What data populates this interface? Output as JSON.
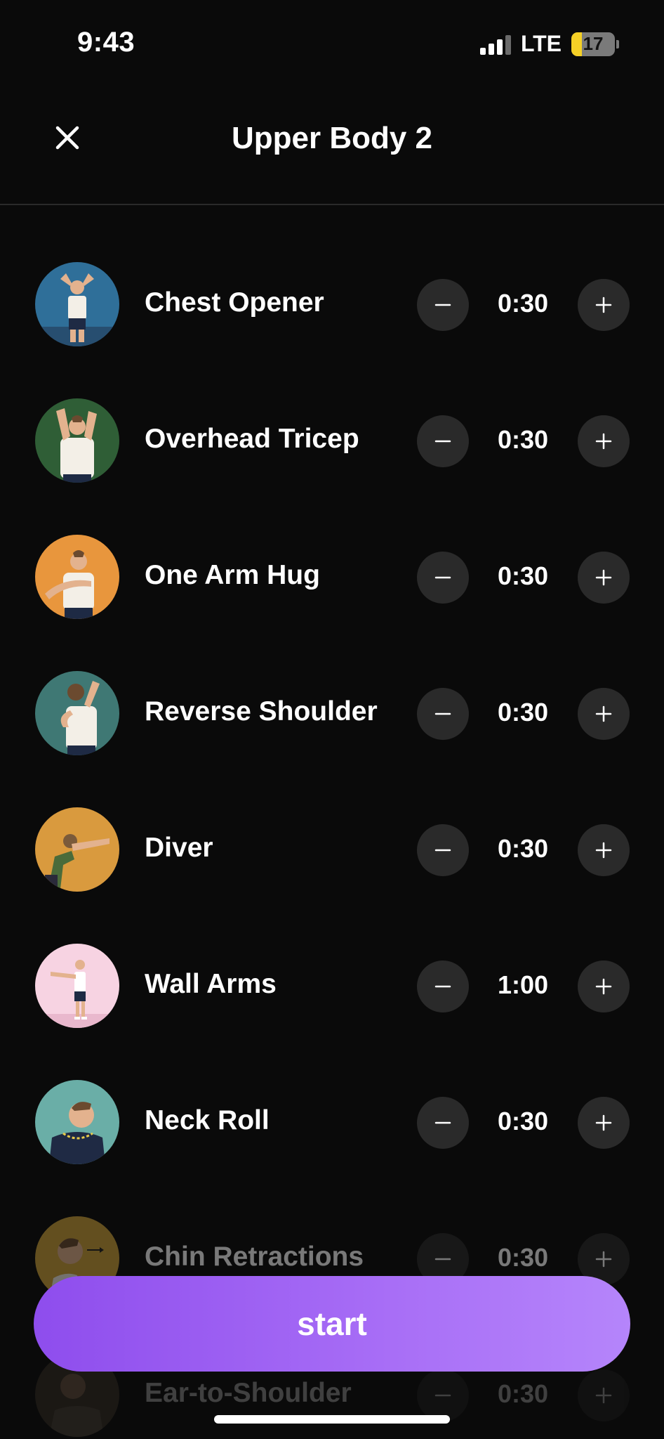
{
  "status_bar": {
    "time": "9:43",
    "network": "LTE",
    "battery_level": "17"
  },
  "header": {
    "title": "Upper Body 2"
  },
  "exercises": [
    {
      "name": "Chest Opener",
      "duration": "0:30",
      "icon": "chest-opener-avatar",
      "avatar_color": "#2f6f99"
    },
    {
      "name": "Overhead Tricep",
      "duration": "0:30",
      "icon": "overhead-tricep-avatar",
      "avatar_color": "#2f5e36"
    },
    {
      "name": "One Arm Hug",
      "duration": "0:30",
      "icon": "one-arm-hug-avatar",
      "avatar_color": "#e8963d"
    },
    {
      "name": "Reverse Shoulder",
      "duration": "0:30",
      "icon": "reverse-shoulder-avatar",
      "avatar_color": "#3f7874"
    },
    {
      "name": "Diver",
      "duration": "0:30",
      "icon": "diver-avatar",
      "avatar_color": "#d99a3e"
    },
    {
      "name": "Wall Arms",
      "duration": "1:00",
      "icon": "wall-arms-avatar",
      "avatar_color": "#f7d3e2"
    },
    {
      "name": "Neck Roll",
      "duration": "0:30",
      "icon": "neck-roll-avatar",
      "avatar_color": "#6aaea7"
    },
    {
      "name": "Chin Retractions",
      "duration": "0:30",
      "icon": "chin-retractions-avatar",
      "avatar_color": "#d0a43a"
    },
    {
      "name": "Ear-to-Shoulder",
      "duration": "0:30",
      "icon": "ear-to-shoulder-avatar",
      "avatar_color": "#5a4a3a"
    }
  ],
  "actions": {
    "start_label": "start"
  },
  "colors": {
    "accent_start": "#8e4ded",
    "accent_end": "#b585fb",
    "background": "#0a0a0a",
    "control_bg": "#2a2a2a"
  }
}
